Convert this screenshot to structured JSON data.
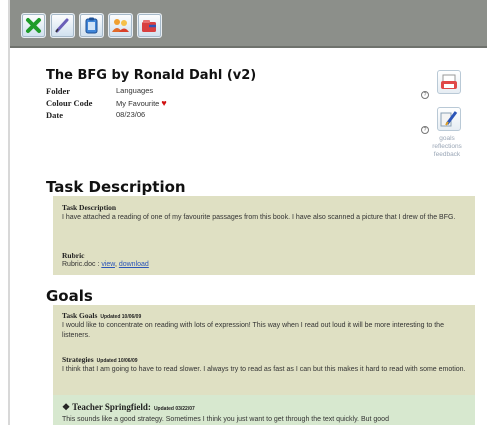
{
  "toolbar": {
    "buttons": [
      {
        "icon": "close-x-icon"
      },
      {
        "icon": "pencil-edit-icon"
      },
      {
        "icon": "clipboard-icon"
      },
      {
        "icon": "share-people-icon"
      },
      {
        "icon": "folder-move-icon"
      }
    ]
  },
  "page": {
    "title": "The BFG by Ronald Dahl (v2)",
    "meta": [
      {
        "key": "Folder",
        "value": "Languages"
      },
      {
        "key": "Colour Code",
        "value": "My Favourite"
      },
      {
        "key": "Date",
        "value": "08/23/06"
      }
    ],
    "side_links": "goals\nreflections\nfeedback",
    "colors": {
      "heart": "#d01010",
      "box": "#dfe0c3",
      "teacher_box": "#d7e8cf",
      "link": "#2b55b8"
    }
  },
  "task": {
    "heading": "Task Description",
    "label": "Task Description",
    "text": "I have attached a reading of one of my favourite passages from this book. I have also scanned a picture that I drew of the BFG.",
    "rubric_label": "Rubric",
    "rubric_file": "Rubric.doc :",
    "view": "view",
    "sep": ",",
    "download": "download"
  },
  "goals": {
    "heading": "Goals",
    "items": [
      {
        "label": "Task Goals",
        "updated": "Updated 10/06/09",
        "text": "I would like to concentrate on reading with lots of expression! This way when I read out loud it will be more interesting to the listeners."
      },
      {
        "label": "Strategies",
        "updated": "Updated 10/06/09",
        "text": "I think that I am going to have to read slower. I always try to read as fast as I can but this makes it hard to read with some emotion."
      }
    ],
    "teacher": {
      "label": "Teacher Springfield:",
      "updated": "Updated 03/22/07",
      "text": "This sounds like a good strategy. Sometimes I think you just want to get through the text quickly. But good"
    }
  }
}
